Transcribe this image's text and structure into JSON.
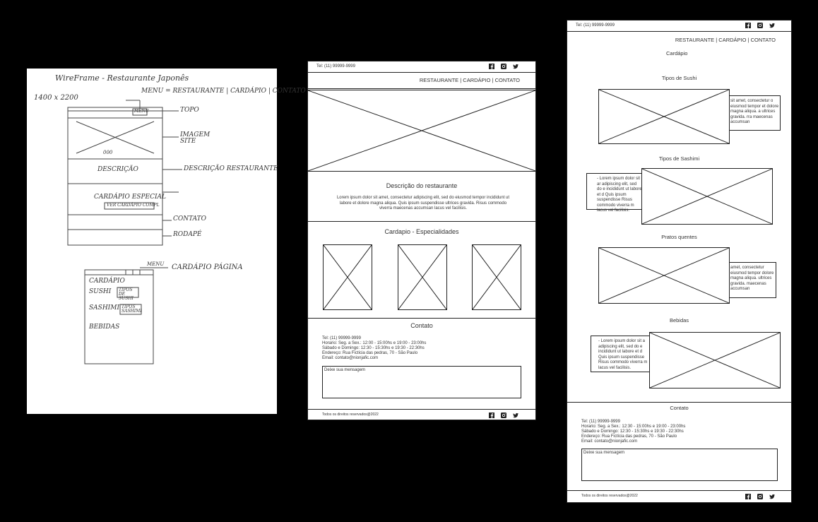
{
  "sketch": {
    "title": "WireFrame - Restaurante Japonês",
    "size": "1400 x 2200",
    "note_menu": "MENU = RESTAURANTE | CARDÁPIO | CONTATO",
    "note_topo": "TOPO",
    "note_imagem": "IMAGEM SITE",
    "note_descricao": "DESCRIÇÃO RESTAURANTE",
    "note_contato": "CONTATO",
    "note_rodape": "RODAPÉ",
    "box_descricao": "DESCRIÇÃO",
    "box_cardapio": "CARDÁPIO ESPECIAL",
    "box_ver": "VER CARDÁPIO COMPL",
    "box_dots": "000",
    "box_menu_mini": "MENU",
    "page2_menu": "MENU",
    "page2_label": "CARDÁPIO PÁGINA",
    "page2_cardapio": "CARDÁPIO",
    "page2_sushi": "SUSHI",
    "page2_tipos_sushi": "TIPOS DE SUSHI",
    "page2_sashimi": "SASHIMI",
    "page2_tipos_sashimi": "TIPOS SASHIMI",
    "page2_bebidas": "BEBIDAS"
  },
  "home": {
    "phone": "Tel: (11) 99999-9999",
    "menu": "RESTAURANTE | CARDÁPIO | CONTATO",
    "desc_title": "Descrição do restaurante",
    "desc_text": "Lorem ipsum dolor sit amet, consectetur adipiscing elit, sed do eiusmod tempor incididunt ut labore et dolore magna aliqua. Quis ipsum suspendisse ultrices gravida. Risus commodo viverra maecenas accumsan lacus vel facilisis.",
    "cardapio_title": "Cardapio - Especialidades",
    "contato_title": "Contato",
    "contato_lines": [
      "Tel: (11) 99999-9999",
      "Horario: Seg. a Sex.: 12:00 - 15:00hs e 19:00 - 23:00hs",
      "Sábado e Domingo: 12:30 - 15:30hs e 19:30 - 22:30hs",
      "Endereço: Rua Fictícia das pedras, 70 - São Paulo",
      "Email: contato@nionjafic.com"
    ],
    "msg_placeholder": "Deixe sua mensagem",
    "footer": "Todos os direitos reservados@2022"
  },
  "menu_page": {
    "phone": "Tel: (11) 99999-9999",
    "menu": "RESTAURANTE | CARDÁPIO | CONTATO",
    "title": "Cardápio",
    "sections": [
      "Tipos de Sushi",
      "Tipos de Sashimi",
      "Pratos quentes",
      "Bebidas"
    ],
    "right_text_1": "sit amet, consectetur o eiusmod tempor et dolore magna aliqua. a ultrices gravida. rra maecenas accumsan",
    "left_text_2": "- Lorem ipsum dolor sit ar adipiscing elit, sed do e incididunt ut labore et d Quis ipsum suspendisse Risus commodo viverra m lacus vel facilisis.",
    "right_text_3": "amet, consectetur eiusmod tempor dolore magna aliqua. ultrices gravida. maecenas accumsan",
    "left_text_4": "- Lorem ipsum dolor sit a adipiscing elit, sed do e incididunt ut labore et d Quis ipsum suspendisse Risus commodo viverra m lacus vel facilisis.",
    "contato_title": "Contato",
    "contato_lines": [
      "Tel: (11) 99999-9999",
      "Horario: Seg. a Sex.: 12:30 - 15:00hs e 19:00 - 23:00hs",
      "Sábado e Domingo: 12:30 - 15:30hs e 19:30 - 22:30hs",
      "Endereço: Rua Fictícia das pedras, 70 - São Paulo",
      "Email: contato@nionjafic.com"
    ],
    "msg_placeholder": "Deixe sua mensagem",
    "footer": "Todos os direitos reservados@2022"
  },
  "icons": [
    "facebook-icon",
    "instagram-icon",
    "twitter-icon"
  ]
}
